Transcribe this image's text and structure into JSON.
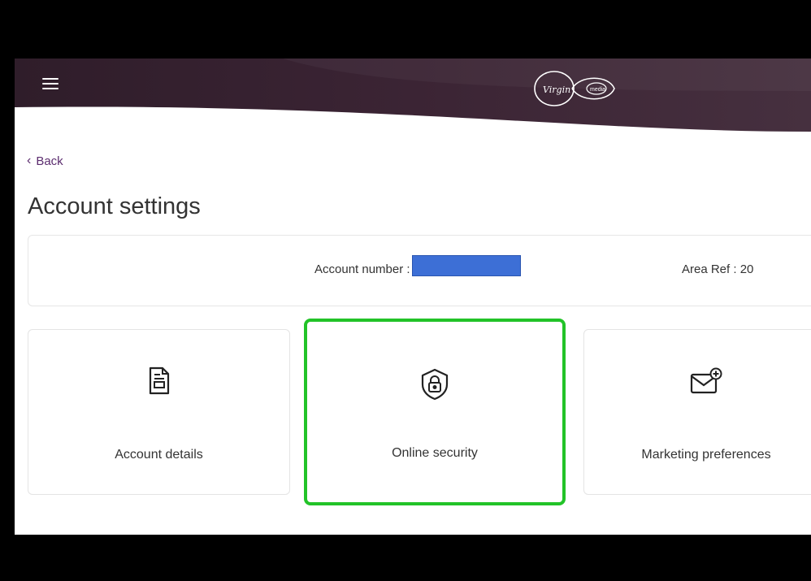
{
  "header": {
    "menu_icon": "hamburger-menu-icon",
    "logo_text_left": "Virgin",
    "logo_text_right": "media",
    "colors": {
      "bar": "#3a2433",
      "accent": "#5c2d6f"
    }
  },
  "nav": {
    "back_label": "Back"
  },
  "page": {
    "title": "Account settings"
  },
  "account": {
    "number_label": "Account number :",
    "area_ref": "Area Ref : 20"
  },
  "cards": [
    {
      "label": "Account details",
      "icon": "document-icon"
    },
    {
      "label": "Online security",
      "icon": "shield-lock-icon",
      "highlighted": true
    },
    {
      "label": "Marketing preferences",
      "icon": "envelope-plus-icon"
    }
  ],
  "highlight_color": "#22c328"
}
